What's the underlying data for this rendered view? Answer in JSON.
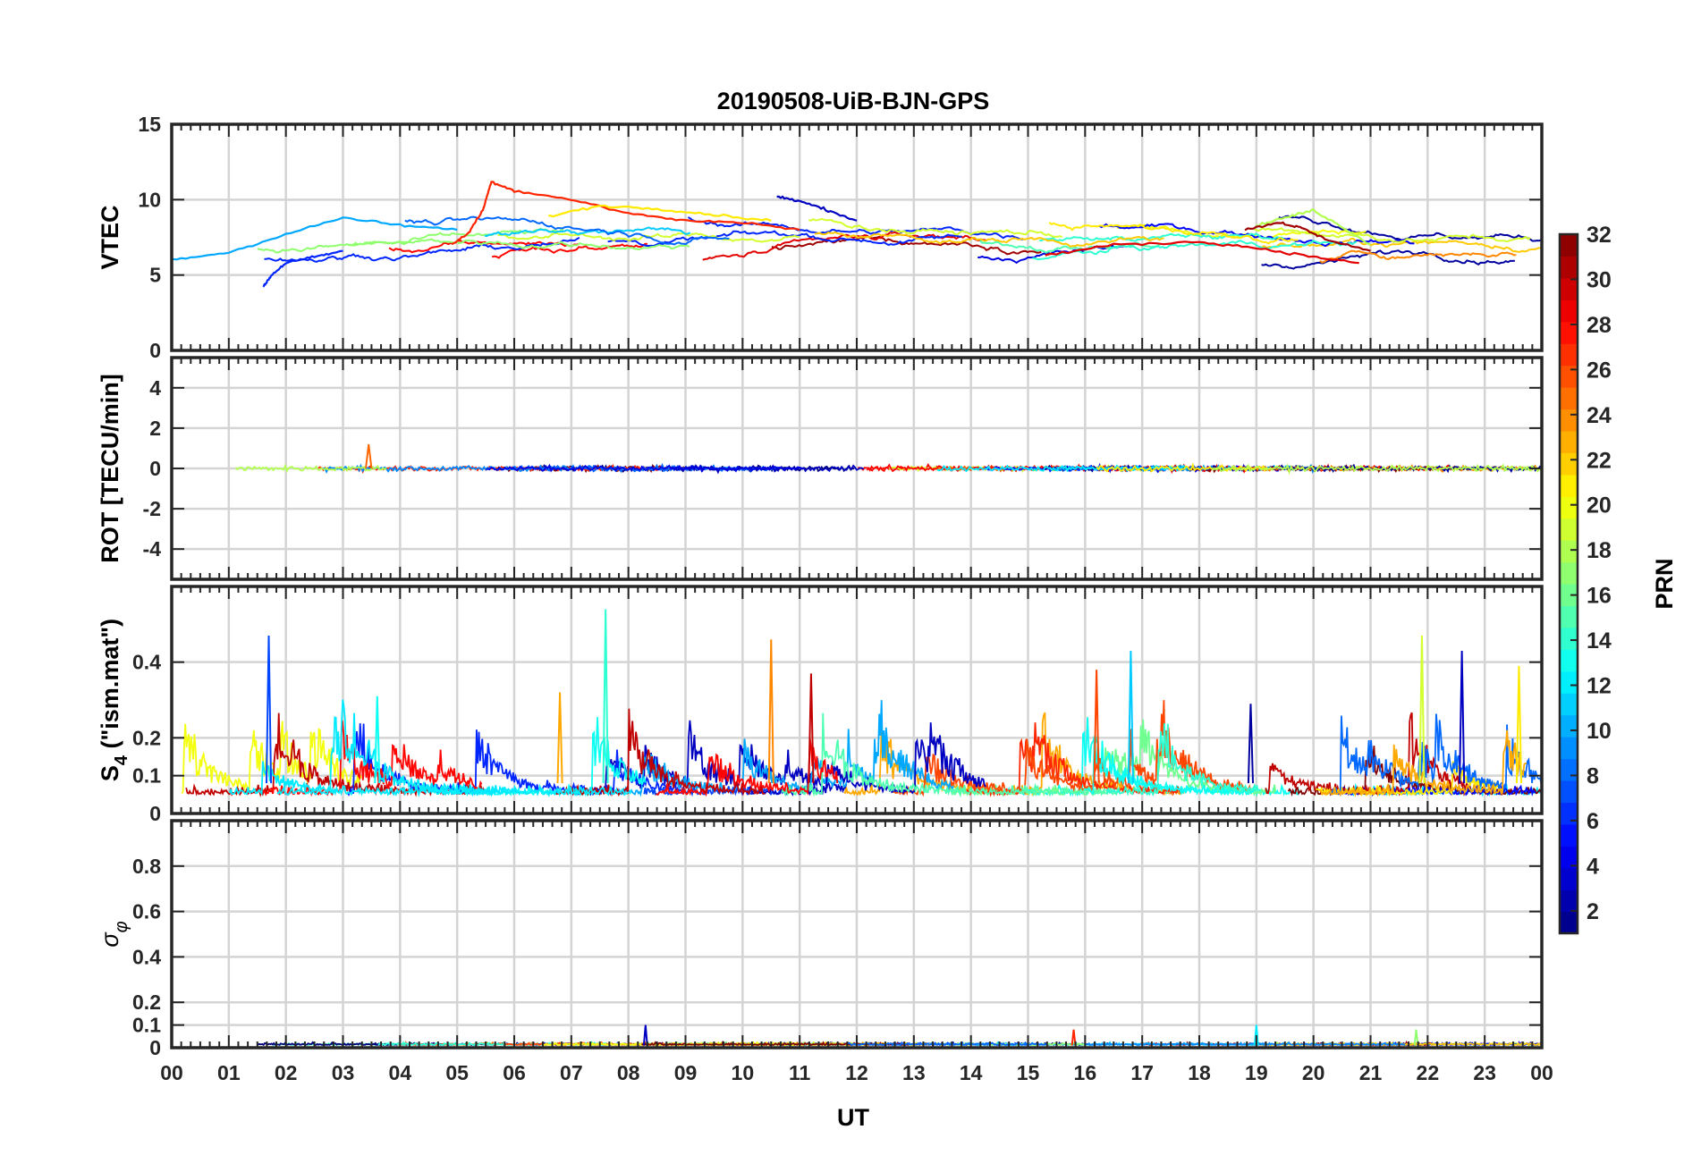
{
  "chart_data": {
    "type": "line",
    "title": "20190508-UiB-BJN-GPS",
    "xlabel": "UT",
    "x_range_hours": [
      0,
      24
    ],
    "x_tick_labels": [
      "00",
      "01",
      "02",
      "03",
      "04",
      "05",
      "06",
      "07",
      "08",
      "09",
      "10",
      "11",
      "12",
      "13",
      "14",
      "15",
      "16",
      "17",
      "18",
      "19",
      "20",
      "21",
      "22",
      "23",
      "00"
    ],
    "grid": true,
    "colorbar": {
      "label": "PRN",
      "range": [
        1,
        32
      ],
      "tick_labels": [
        "2",
        "4",
        "6",
        "8",
        "10",
        "12",
        "14",
        "16",
        "18",
        "20",
        "22",
        "24",
        "26",
        "28",
        "30",
        "32"
      ],
      "colormap": "jet"
    },
    "panels": [
      {
        "id": "vtec",
        "ylabel": "VTEC",
        "ylim": [
          0,
          15
        ],
        "y_ticks": [
          0,
          5,
          10,
          15
        ],
        "y_tick_labels": [
          "0",
          "5",
          "10",
          "15"
        ],
        "typical_range": [
          5.5,
          9
        ],
        "series": [
          {
            "prn": 27,
            "x": [
              4.9,
              5.2,
              5.45,
              5.6,
              6.0,
              7.0,
              8.0,
              9.0,
              10.0,
              11.0
            ],
            "y": [
              7.0,
              7.8,
              9.3,
              11.2,
              10.6,
              10.0,
              9.1,
              8.6,
              8.5,
              8.0
            ]
          },
          {
            "prn": 3,
            "x": [
              10.6,
              11.0,
              11.5,
              12.0
            ],
            "y": [
              10.2,
              9.9,
              9.3,
              8.6
            ]
          },
          {
            "prn": 6,
            "x": [
              1.6,
              1.75,
              2.0,
              2.5,
              3.0
            ],
            "y": [
              4.2,
              5.0,
              5.8,
              6.2,
              6.6
            ]
          },
          {
            "prn": 10,
            "x": [
              0.0,
              1.0,
              2.0,
              3.0,
              4.0,
              5.0
            ],
            "y": [
              6.0,
              6.5,
              7.7,
              8.8,
              8.3,
              8.0
            ]
          },
          {
            "prn": 21,
            "x": [
              6.6,
              7.5,
              8.5,
              9.5,
              10.5
            ],
            "y": [
              8.9,
              9.6,
              9.4,
              9.0,
              8.6
            ]
          },
          {
            "prn": 18,
            "x": [
              19.0,
              19.6,
              20.0,
              20.5,
              21.0
            ],
            "y": [
              8.3,
              8.9,
              9.3,
              8.2,
              7.0
            ]
          },
          {
            "prn": 31,
            "x": [
              18.8,
              19.4,
              19.8,
              20.2,
              21.0
            ],
            "y": [
              8.0,
              8.5,
              8.1,
              7.4,
              6.6
            ]
          },
          {
            "prn": 29,
            "x": [
              15.3,
              16.5,
              18.0,
              19.0,
              20.0,
              20.8
            ],
            "y": [
              6.3,
              7.0,
              7.2,
              6.8,
              6.2,
              5.8
            ]
          }
        ]
      },
      {
        "id": "rot",
        "ylabel": "ROT [TECU/min]",
        "ylim": [
          -5.5,
          5.5
        ],
        "y_ticks": [
          -4,
          -2,
          0,
          2,
          4
        ],
        "y_tick_labels": [
          "-4",
          "-2",
          "0",
          "2",
          "4"
        ],
        "typical_range": [
          -0.5,
          0.5
        ],
        "peak": {
          "x": 3.45,
          "y": 1.2
        }
      },
      {
        "id": "s4",
        "ylabel": "S4 (\"ism.mat\")",
        "ylabel_main": "S",
        "ylabel_sub": "4",
        "ylabel_rest": " (\"ism.mat\")",
        "ylim": [
          0,
          0.6
        ],
        "y_ticks": [
          0,
          0.1,
          0.2,
          0.4
        ],
        "y_tick_labels": [
          "0",
          "0.1",
          "0.2",
          "0.4"
        ],
        "typical_range": [
          0.03,
          0.15
        ],
        "spikes": [
          {
            "x": 1.7,
            "y": 0.47,
            "prn": 7
          },
          {
            "x": 3.6,
            "y": 0.31,
            "prn": 13
          },
          {
            "x": 6.8,
            "y": 0.32,
            "prn": 23
          },
          {
            "x": 7.6,
            "y": 0.54,
            "prn": 14
          },
          {
            "x": 10.5,
            "y": 0.46,
            "prn": 24
          },
          {
            "x": 11.2,
            "y": 0.37,
            "prn": 30
          },
          {
            "x": 16.2,
            "y": 0.38,
            "prn": 26
          },
          {
            "x": 16.8,
            "y": 0.43,
            "prn": 11
          },
          {
            "x": 18.9,
            "y": 0.29,
            "prn": 2
          },
          {
            "x": 21.9,
            "y": 0.47,
            "prn": 19
          },
          {
            "x": 22.6,
            "y": 0.43,
            "prn": 3
          },
          {
            "x": 23.6,
            "y": 0.39,
            "prn": 21
          }
        ]
      },
      {
        "id": "sigma_phi",
        "ylabel": "σφ",
        "ylabel_main": "σ",
        "ylabel_sub": "φ",
        "ylim": [
          0,
          1
        ],
        "y_ticks": [
          0,
          0.1,
          0.2,
          0.4,
          0.6,
          0.8
        ],
        "y_tick_labels": [
          "0",
          "0.1",
          "0.2",
          "0.4",
          "0.6",
          "0.8"
        ],
        "typical_range": [
          0.0,
          0.04
        ],
        "spikes": [
          {
            "x": 8.3,
            "y": 0.1,
            "prn": 3
          },
          {
            "x": 15.8,
            "y": 0.08,
            "prn": 27
          },
          {
            "x": 19.0,
            "y": 0.1,
            "prn": 12
          },
          {
            "x": 21.8,
            "y": 0.08,
            "prn": 17
          }
        ]
      }
    ]
  }
}
